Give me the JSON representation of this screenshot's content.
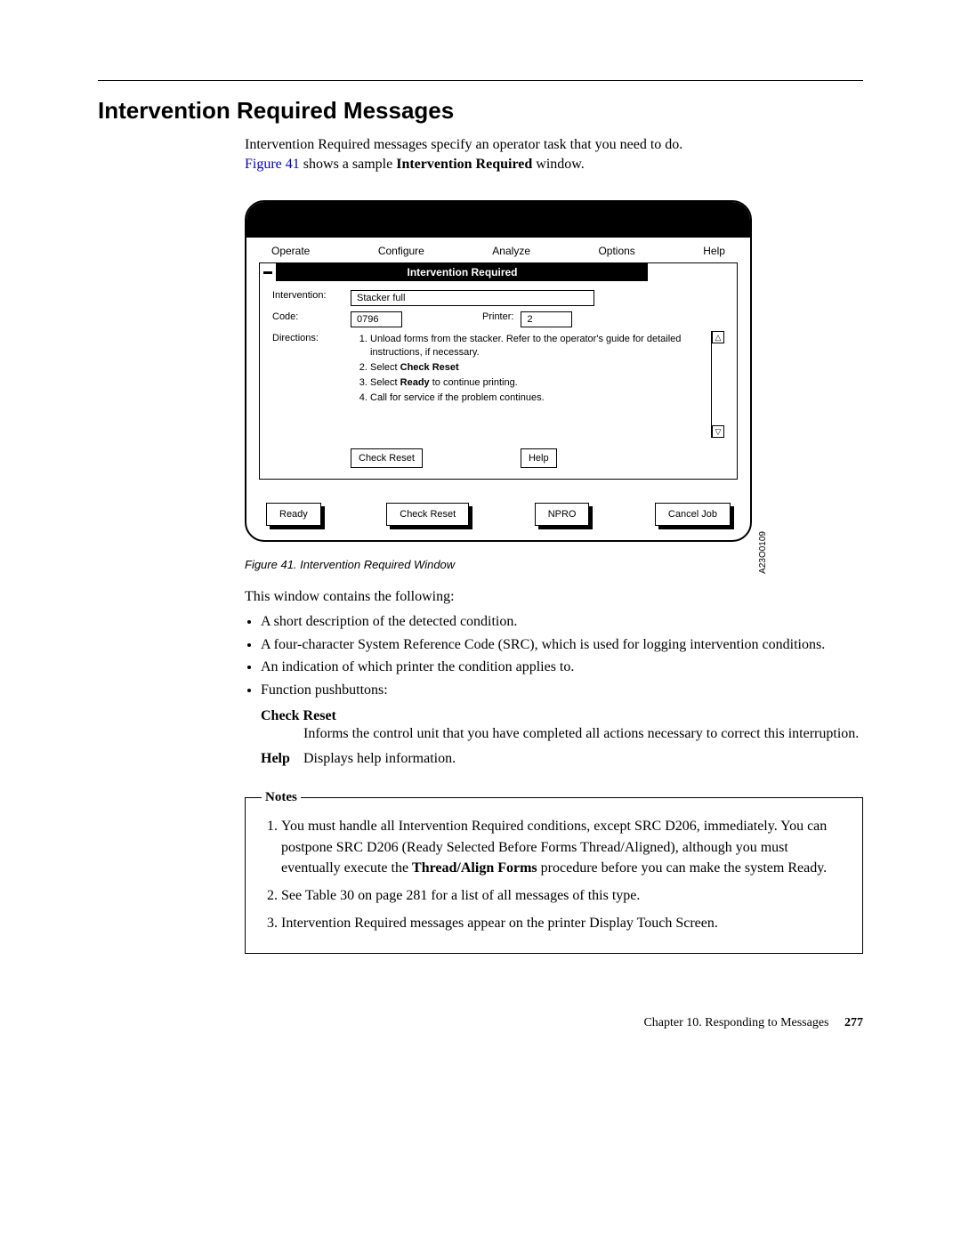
{
  "heading": "Intervention Required Messages",
  "intro_1": "Intervention Required messages specify an operator task that you need to do.",
  "intro_link": "Figure 41",
  "intro_2_before": " shows a sample ",
  "intro_2_bold": "Intervention Required",
  "intro_2_after": " window.",
  "figure": {
    "menu": {
      "operate": "Operate",
      "configure": "Configure",
      "analyze": "Analyze",
      "options": "Options",
      "help": "Help"
    },
    "inner_title": "Intervention Required",
    "labels": {
      "intervention": "Intervention:",
      "code": "Code:",
      "printer": "Printer:",
      "directions": "Directions:"
    },
    "values": {
      "intervention": "Stacker full",
      "code": "0796",
      "printer": "2"
    },
    "directions": {
      "d1": "Unload forms from the stacker. Refer to the operator's guide for detailed instructions, if necessary.",
      "d2a": "Select ",
      "d2b": "Check Reset",
      "d3a": "Select ",
      "d3b": "Ready",
      "d3c": " to continue printing.",
      "d4": "Call for service if the problem continues."
    },
    "inner_buttons": {
      "check_reset": "Check Reset",
      "help": "Help"
    },
    "bottom_buttons": {
      "ready": "Ready",
      "check_reset": "Check Reset",
      "npro": "NPRO",
      "cancel_job": "Cancel Job"
    },
    "side_code": "A23O0109",
    "caption": "Figure 41. Intervention Required Window"
  },
  "after_fig_intro": "This window contains the following:",
  "bullets": {
    "b1": "A short description of the detected condition.",
    "b2": "A four-character System Reference Code (SRC), which is used for logging intervention conditions.",
    "b3": "An indication of which printer the condition applies to.",
    "b4": "Function pushbuttons:"
  },
  "defs": {
    "check_reset_term": "Check Reset",
    "check_reset_def": "Informs the control unit that you have completed all actions necessary to correct this interruption.",
    "help_term": "Help",
    "help_def": "Displays help information."
  },
  "notes": {
    "legend": "Notes",
    "n1a": "You must handle all Intervention Required conditions, except SRC D206, immediately. You can postpone SRC D206 (Ready Selected Before Forms Thread/Aligned), although you must eventually execute the ",
    "n1b": "Thread/Align Forms",
    "n1c": " procedure before you can make the system Ready.",
    "n2": "See Table 30 on page 281 for a list of all messages of this type.",
    "n3": "Intervention Required messages appear on the printer Display Touch Screen."
  },
  "footer": {
    "chapter": "Chapter 10. Responding to Messages",
    "page": "277"
  }
}
